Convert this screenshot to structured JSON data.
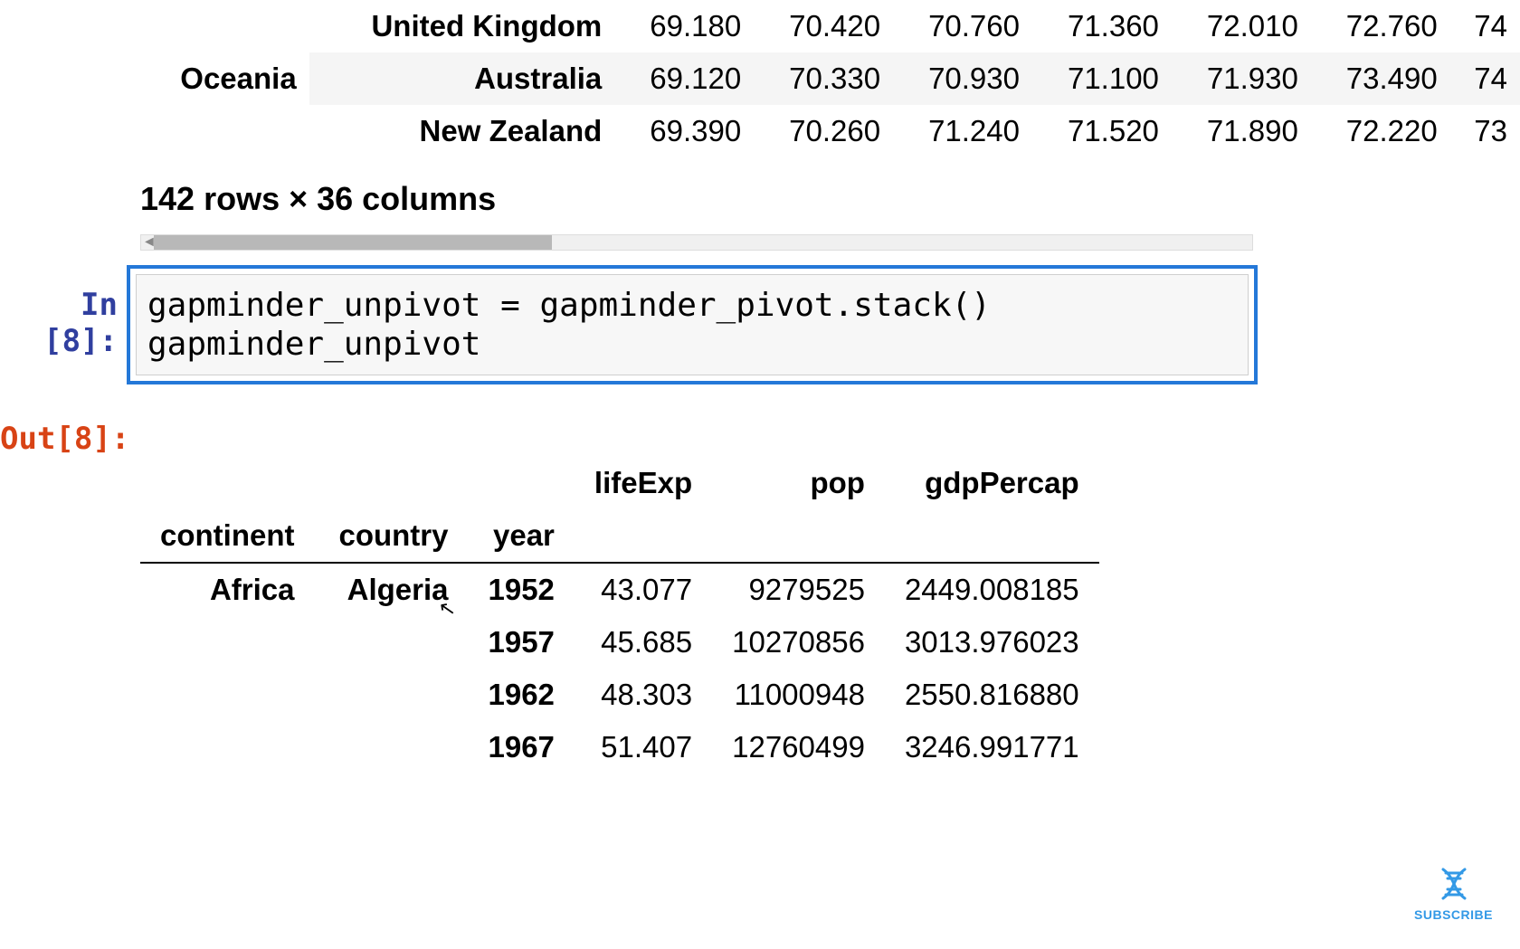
{
  "top_table": {
    "rows": [
      {
        "continent": "",
        "country": "United Kingdom",
        "vals": [
          "69.180",
          "70.420",
          "70.760",
          "71.360",
          "72.010",
          "72.760",
          "74"
        ]
      },
      {
        "continent": "Oceania",
        "country": "Australia",
        "vals": [
          "69.120",
          "70.330",
          "70.930",
          "71.100",
          "71.930",
          "73.490",
          "74"
        ]
      },
      {
        "continent": "",
        "country": "New Zealand",
        "vals": [
          "69.390",
          "70.260",
          "71.240",
          "71.520",
          "71.890",
          "72.220",
          "73"
        ]
      }
    ],
    "shape_text": "142 rows × 36 columns"
  },
  "code_cell": {
    "in_label": "In [8]:",
    "out_label": "Out[8]:",
    "line1": "gapminder_unpivot = gapminder_pivot.stack()",
    "line2": "gapminder_unpivot"
  },
  "out_table": {
    "headers_top": [
      "",
      "",
      "",
      "lifeExp",
      "pop",
      "gdpPercap"
    ],
    "headers_idx": [
      "continent",
      "country",
      "year",
      "",
      "",
      ""
    ],
    "rows": [
      {
        "continent": "Africa",
        "country": "Algeria",
        "year": "1952",
        "lifeExp": "43.077",
        "pop": "9279525",
        "gdp": "2449.008185"
      },
      {
        "continent": "",
        "country": "",
        "year": "1957",
        "lifeExp": "45.685",
        "pop": "10270856",
        "gdp": "3013.976023"
      },
      {
        "continent": "",
        "country": "",
        "year": "1962",
        "lifeExp": "48.303",
        "pop": "11000948",
        "gdp": "2550.816880"
      },
      {
        "continent": "",
        "country": "",
        "year": "1967",
        "lifeExp": "51.407",
        "pop": "12760499",
        "gdp": "3246.991771"
      }
    ]
  },
  "subscribe_label": "SUBSCRIBE"
}
